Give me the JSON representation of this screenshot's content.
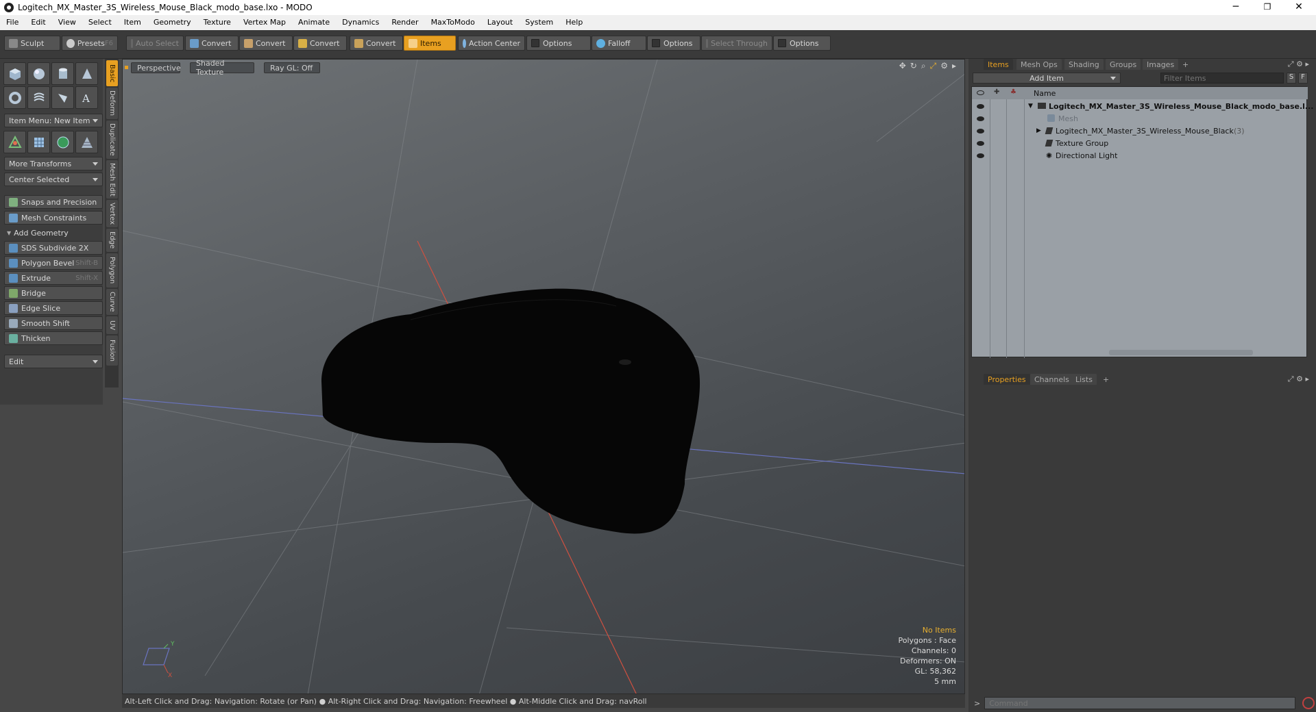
{
  "window": {
    "title": "Logitech_MX_Master_3S_Wireless_Mouse_Black_modo_base.lxo - MODO",
    "minimize": "─",
    "maximize": "❐",
    "close": "✕"
  },
  "menu": [
    "File",
    "Edit",
    "View",
    "Select",
    "Item",
    "Geometry",
    "Texture",
    "Vertex Map",
    "Animate",
    "Dynamics",
    "Render",
    "MaxToModo",
    "Layout",
    "System",
    "Help"
  ],
  "toolbar": {
    "sculpt": "Sculpt",
    "presets": "Presets",
    "presets_shortcut": "F6",
    "auto_select": "Auto Select",
    "convert1": "Convert",
    "convert2": "Convert",
    "convert3": "Convert",
    "convert4": "Convert",
    "items": "Items",
    "action_center": "Action Center",
    "options1": "Options",
    "falloff": "Falloff",
    "options2": "Options",
    "select_through": "Select Through",
    "options3": "Options"
  },
  "left": {
    "item_menu": "Item Menu: New Item",
    "more_transforms": "More Transforms",
    "center_selected": "Center Selected",
    "snaps": "Snaps and Precision",
    "mesh_constraints": "Mesh Constraints",
    "add_geometry": "Add Geometry",
    "sds": "SDS Subdivide 2X",
    "polygon_bevel": "Polygon Bevel",
    "polygon_bevel_sc": "Shift-B",
    "extrude": "Extrude",
    "extrude_sc": "Shift-X",
    "bridge": "Bridge",
    "edge_slice": "Edge Slice",
    "smooth_shift": "Smooth Shift",
    "thicken": "Thicken",
    "edit": "Edit"
  },
  "vtabs": [
    "Basic",
    "Deform",
    "Duplicate",
    "Mesh Edit",
    "Vertex",
    "Edge",
    "Polygon",
    "Curve",
    "UV",
    "Fusion"
  ],
  "viewport": {
    "perspective": "Perspective",
    "shaded": "Shaded Texture",
    "raygl": "Ray GL: Off",
    "info": {
      "no_items": "No Items",
      "polygons": "Polygons : Face",
      "channels": "Channels: 0",
      "deformers": "Deformers: ON",
      "gl": "GL: 58,362",
      "scale": "5 mm"
    }
  },
  "status": "Alt-Left Click and Drag: Navigation: Rotate (or Pan) ● Alt-Right Click and Drag: Navigation: Freewheel ● Alt-Middle Click and Drag: navRoll",
  "right": {
    "tabs": [
      "Items",
      "Mesh Ops",
      "Shading",
      "Groups",
      "Images",
      "+"
    ],
    "add_item": "Add Item",
    "filter": "Filter Items",
    "s": "S",
    "f": "F",
    "name_col": "Name",
    "rows": [
      {
        "label": "Logitech_MX_Master_3S_Wireless_Mouse_Black_modo_base.l..."
      },
      {
        "label": "Mesh"
      },
      {
        "label": "Logitech_MX_Master_3S_Wireless_Mouse_Black",
        "count": "(3)"
      },
      {
        "label": "Texture Group"
      },
      {
        "label": "Directional Light"
      }
    ],
    "prop_tabs": [
      "Properties",
      "Channels",
      "Lists",
      "+"
    ],
    "command_placeholder": "Command"
  }
}
